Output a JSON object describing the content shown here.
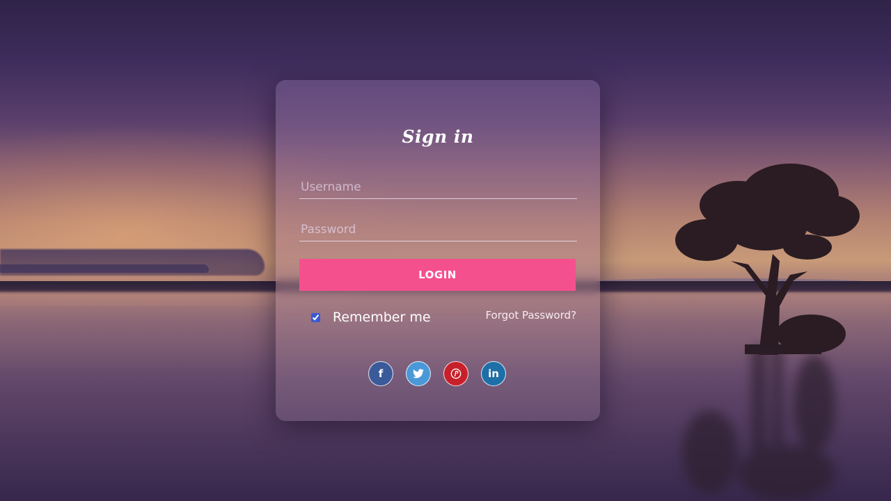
{
  "login_form": {
    "title": "Sign in",
    "username_placeholder": "Username",
    "password_placeholder": "Password",
    "login_label": "LOGIN",
    "remember_label": "Remember me",
    "remember_checked": true,
    "forgot_label": "Forgot Password?"
  },
  "social": [
    {
      "icon": "facebook-icon",
      "glyph": "f",
      "color": "#3b5a9a"
    },
    {
      "icon": "twitter-icon",
      "glyph": "🐦",
      "color": "#4a98d8"
    },
    {
      "icon": "pinterest-icon",
      "glyph": "P",
      "color": "#c8202a"
    },
    {
      "icon": "linkedin-icon",
      "glyph": "in",
      "color": "#1e6fa8"
    }
  ],
  "colors": {
    "accent": "#f5508e"
  }
}
